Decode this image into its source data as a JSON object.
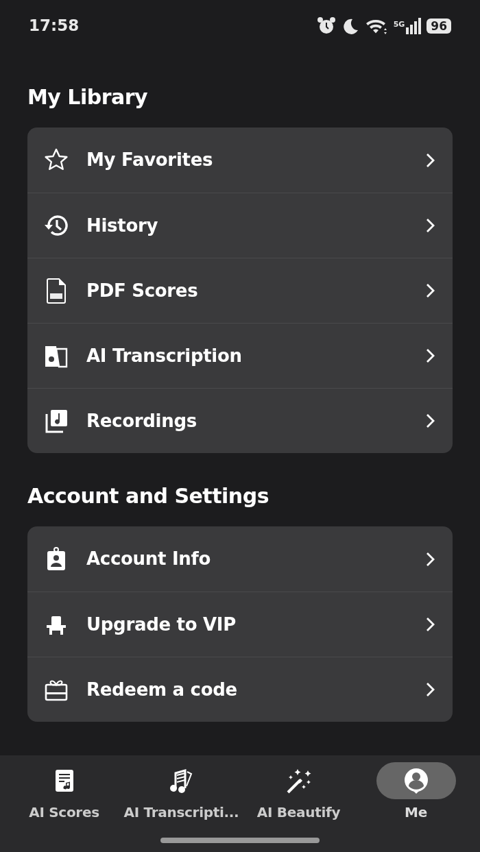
{
  "status_bar": {
    "time": "17:58",
    "network": "5G",
    "battery": "96"
  },
  "sections": [
    {
      "title": "My Library",
      "items": [
        {
          "label": "My Favorites"
        },
        {
          "label": "History"
        },
        {
          "label": "PDF Scores"
        },
        {
          "label": "AI Transcription"
        },
        {
          "label": "Recordings"
        }
      ]
    },
    {
      "title": "Account and Settings",
      "items": [
        {
          "label": "Account Info"
        },
        {
          "label": "Upgrade to VIP"
        },
        {
          "label": "Redeem a code"
        }
      ]
    }
  ],
  "tab_bar": [
    {
      "label": "AI Scores",
      "selected": false
    },
    {
      "label": "AI Transcripti...",
      "selected": false
    },
    {
      "label": "AI Beautify",
      "selected": false
    },
    {
      "label": "Me",
      "selected": true
    }
  ]
}
